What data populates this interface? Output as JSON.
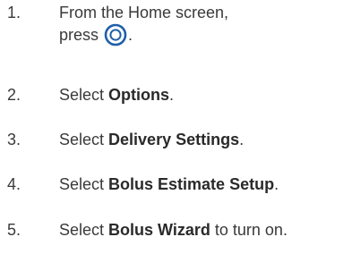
{
  "steps": [
    {
      "number": "1.",
      "line1": "From the Home screen,",
      "line2_prefix": "press ",
      "line2_suffix": ".",
      "icon": "select-button-icon"
    },
    {
      "number": "2.",
      "prefix": "Select ",
      "bold": "Options",
      "suffix": "."
    },
    {
      "number": "3.",
      "prefix": "Select ",
      "bold": "Delivery Settings",
      "suffix": "."
    },
    {
      "number": "4.",
      "prefix": "Select ",
      "bold": "Bolus Estimate Setup",
      "suffix": "."
    },
    {
      "number": "5.",
      "prefix": "Select ",
      "bold": "Bolus Wizard",
      "suffix": " to turn on."
    }
  ],
  "colors": {
    "text": "#3a3a3a",
    "icon_ring": "#1f5fa8"
  }
}
